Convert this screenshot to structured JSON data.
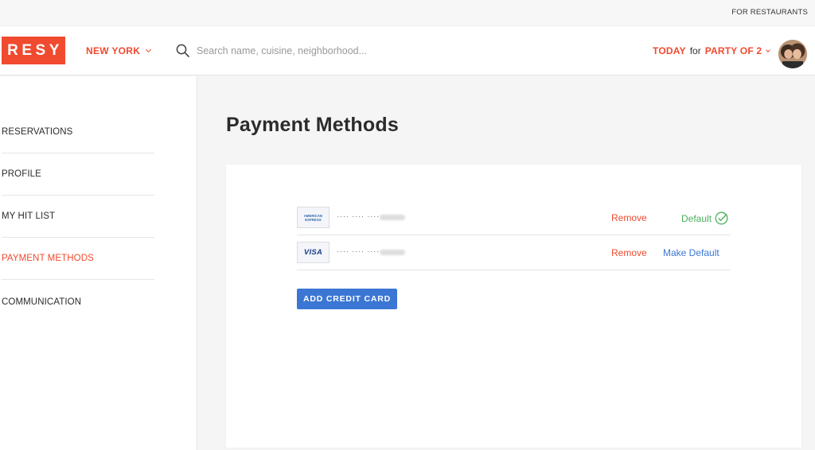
{
  "topbar": {
    "for_restaurants": "FOR RESTAURANTS"
  },
  "header": {
    "logo_text": "RESY",
    "city": "NEW YORK",
    "search_placeholder": "Search name, cuisine, neighborhood...",
    "date_label": "TODAY",
    "for_label": "for",
    "party_label": "PARTY OF 2"
  },
  "sidebar": {
    "items": [
      {
        "label": "RESERVATIONS"
      },
      {
        "label": "PROFILE"
      },
      {
        "label": "MY HIT LIST"
      },
      {
        "label": "PAYMENT METHODS",
        "active": true
      },
      {
        "label": "COMMUNICATION"
      }
    ]
  },
  "main": {
    "title": "Payment Methods",
    "cards": [
      {
        "brand": "amex",
        "brand_line1": "AMERICAN",
        "brand_line2": "EXPRESS",
        "masked": "···· ···· ····",
        "remove_label": "Remove",
        "status_label": "Default",
        "is_default": true
      },
      {
        "brand": "visa",
        "brand_label": "VISA",
        "masked": "···· ···· ····",
        "remove_label": "Remove",
        "status_label": "Make Default",
        "is_default": false
      }
    ],
    "add_button": "ADD CREDIT CARD"
  },
  "colors": {
    "brand": "#f04a2f",
    "link_blue": "#3b76d4",
    "default_green": "#4cb05a"
  }
}
